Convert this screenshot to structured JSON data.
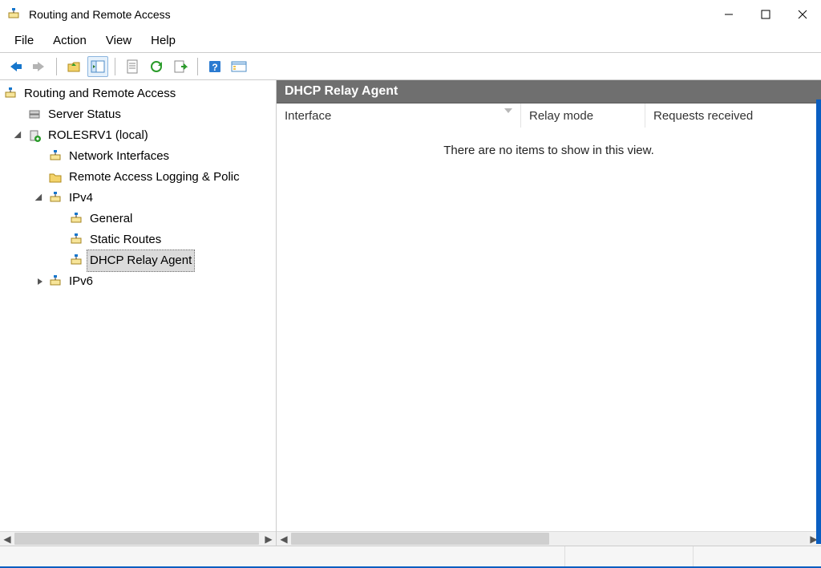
{
  "window": {
    "title": "Routing and Remote Access"
  },
  "menu": {
    "file": "File",
    "action": "Action",
    "view": "View",
    "help": "Help"
  },
  "tree": {
    "root": "Routing and Remote Access",
    "serverStatus": "Server Status",
    "server": "ROLESRV1 (local)",
    "networkInterfaces": "Network Interfaces",
    "remoteAccessLogging": "Remote Access Logging & Polic",
    "ipv4": "IPv4",
    "general": "General",
    "staticRoutes": "Static Routes",
    "dhcpRelay": "DHCP Relay Agent",
    "ipv6": "IPv6"
  },
  "rightPane": {
    "title": "DHCP Relay Agent",
    "columns": {
      "interface": "Interface",
      "relayMode": "Relay mode",
      "requestsReceived": "Requests received"
    },
    "emptyMessage": "There are no items to show in this view."
  }
}
